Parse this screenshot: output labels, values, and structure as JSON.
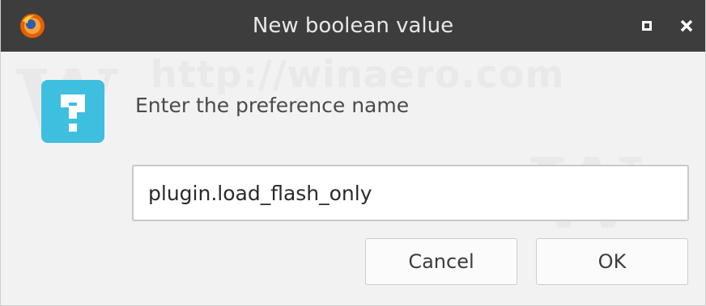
{
  "window": {
    "title": "New boolean value",
    "app_icon": "firefox-icon"
  },
  "titlebar_buttons": {
    "maximize_icon": "maximize-icon",
    "close_icon": "close-icon"
  },
  "dialog": {
    "icon": "question-icon",
    "prompt": "Enter the preference name",
    "input_value": "plugin.load_flash_only",
    "cancel_label": "Cancel",
    "ok_label": "OK"
  },
  "watermark": {
    "text": "http://winaero.com"
  },
  "colors": {
    "titlebar": "#3d3d3d",
    "question_icon": "#3fbfe0",
    "dialog_background": "#f2f2f2"
  }
}
